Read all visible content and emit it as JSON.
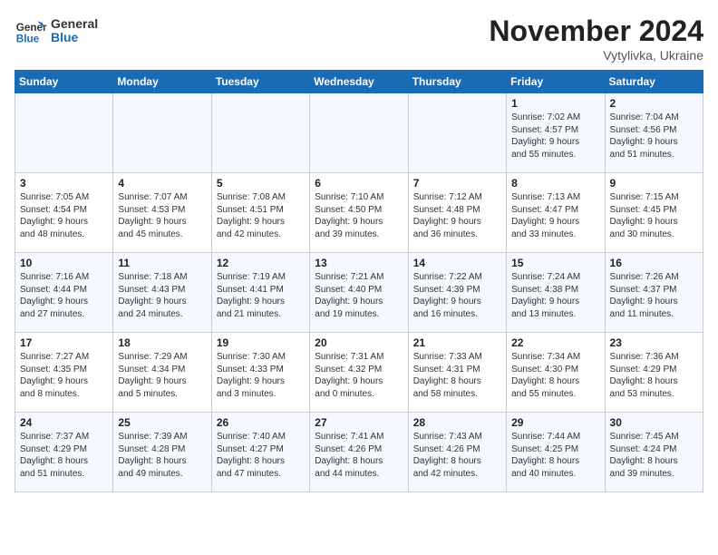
{
  "logo": {
    "line1": "General",
    "line2": "Blue"
  },
  "title": "November 2024",
  "location": "Vytylivka, Ukraine",
  "weekdays": [
    "Sunday",
    "Monday",
    "Tuesday",
    "Wednesday",
    "Thursday",
    "Friday",
    "Saturday"
  ],
  "weeks": [
    [
      {
        "day": "",
        "text": ""
      },
      {
        "day": "",
        "text": ""
      },
      {
        "day": "",
        "text": ""
      },
      {
        "day": "",
        "text": ""
      },
      {
        "day": "",
        "text": ""
      },
      {
        "day": "1",
        "text": "Sunrise: 7:02 AM\nSunset: 4:57 PM\nDaylight: 9 hours\nand 55 minutes."
      },
      {
        "day": "2",
        "text": "Sunrise: 7:04 AM\nSunset: 4:56 PM\nDaylight: 9 hours\nand 51 minutes."
      }
    ],
    [
      {
        "day": "3",
        "text": "Sunrise: 7:05 AM\nSunset: 4:54 PM\nDaylight: 9 hours\nand 48 minutes."
      },
      {
        "day": "4",
        "text": "Sunrise: 7:07 AM\nSunset: 4:53 PM\nDaylight: 9 hours\nand 45 minutes."
      },
      {
        "day": "5",
        "text": "Sunrise: 7:08 AM\nSunset: 4:51 PM\nDaylight: 9 hours\nand 42 minutes."
      },
      {
        "day": "6",
        "text": "Sunrise: 7:10 AM\nSunset: 4:50 PM\nDaylight: 9 hours\nand 39 minutes."
      },
      {
        "day": "7",
        "text": "Sunrise: 7:12 AM\nSunset: 4:48 PM\nDaylight: 9 hours\nand 36 minutes."
      },
      {
        "day": "8",
        "text": "Sunrise: 7:13 AM\nSunset: 4:47 PM\nDaylight: 9 hours\nand 33 minutes."
      },
      {
        "day": "9",
        "text": "Sunrise: 7:15 AM\nSunset: 4:45 PM\nDaylight: 9 hours\nand 30 minutes."
      }
    ],
    [
      {
        "day": "10",
        "text": "Sunrise: 7:16 AM\nSunset: 4:44 PM\nDaylight: 9 hours\nand 27 minutes."
      },
      {
        "day": "11",
        "text": "Sunrise: 7:18 AM\nSunset: 4:43 PM\nDaylight: 9 hours\nand 24 minutes."
      },
      {
        "day": "12",
        "text": "Sunrise: 7:19 AM\nSunset: 4:41 PM\nDaylight: 9 hours\nand 21 minutes."
      },
      {
        "day": "13",
        "text": "Sunrise: 7:21 AM\nSunset: 4:40 PM\nDaylight: 9 hours\nand 19 minutes."
      },
      {
        "day": "14",
        "text": "Sunrise: 7:22 AM\nSunset: 4:39 PM\nDaylight: 9 hours\nand 16 minutes."
      },
      {
        "day": "15",
        "text": "Sunrise: 7:24 AM\nSunset: 4:38 PM\nDaylight: 9 hours\nand 13 minutes."
      },
      {
        "day": "16",
        "text": "Sunrise: 7:26 AM\nSunset: 4:37 PM\nDaylight: 9 hours\nand 11 minutes."
      }
    ],
    [
      {
        "day": "17",
        "text": "Sunrise: 7:27 AM\nSunset: 4:35 PM\nDaylight: 9 hours\nand 8 minutes."
      },
      {
        "day": "18",
        "text": "Sunrise: 7:29 AM\nSunset: 4:34 PM\nDaylight: 9 hours\nand 5 minutes."
      },
      {
        "day": "19",
        "text": "Sunrise: 7:30 AM\nSunset: 4:33 PM\nDaylight: 9 hours\nand 3 minutes."
      },
      {
        "day": "20",
        "text": "Sunrise: 7:31 AM\nSunset: 4:32 PM\nDaylight: 9 hours\nand 0 minutes."
      },
      {
        "day": "21",
        "text": "Sunrise: 7:33 AM\nSunset: 4:31 PM\nDaylight: 8 hours\nand 58 minutes."
      },
      {
        "day": "22",
        "text": "Sunrise: 7:34 AM\nSunset: 4:30 PM\nDaylight: 8 hours\nand 55 minutes."
      },
      {
        "day": "23",
        "text": "Sunrise: 7:36 AM\nSunset: 4:29 PM\nDaylight: 8 hours\nand 53 minutes."
      }
    ],
    [
      {
        "day": "24",
        "text": "Sunrise: 7:37 AM\nSunset: 4:29 PM\nDaylight: 8 hours\nand 51 minutes."
      },
      {
        "day": "25",
        "text": "Sunrise: 7:39 AM\nSunset: 4:28 PM\nDaylight: 8 hours\nand 49 minutes."
      },
      {
        "day": "26",
        "text": "Sunrise: 7:40 AM\nSunset: 4:27 PM\nDaylight: 8 hours\nand 47 minutes."
      },
      {
        "day": "27",
        "text": "Sunrise: 7:41 AM\nSunset: 4:26 PM\nDaylight: 8 hours\nand 44 minutes."
      },
      {
        "day": "28",
        "text": "Sunrise: 7:43 AM\nSunset: 4:26 PM\nDaylight: 8 hours\nand 42 minutes."
      },
      {
        "day": "29",
        "text": "Sunrise: 7:44 AM\nSunset: 4:25 PM\nDaylight: 8 hours\nand 40 minutes."
      },
      {
        "day": "30",
        "text": "Sunrise: 7:45 AM\nSunset: 4:24 PM\nDaylight: 8 hours\nand 39 minutes."
      }
    ]
  ]
}
